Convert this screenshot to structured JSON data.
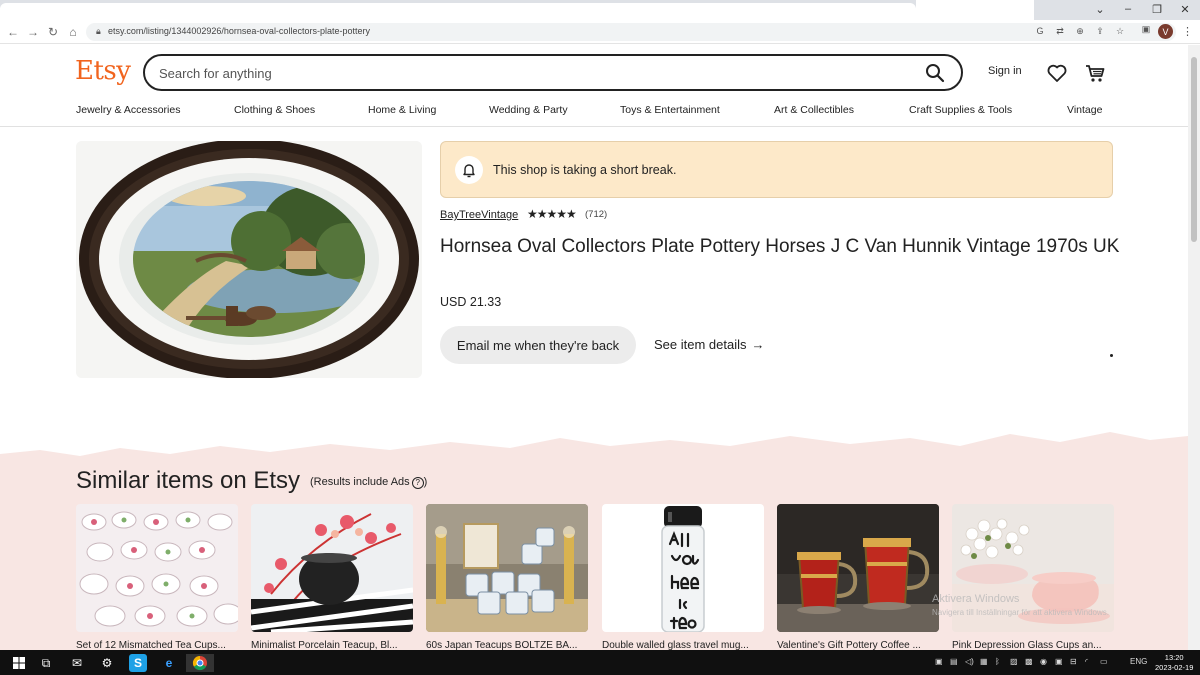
{
  "browser": {
    "url": "etsy.com/listing/1344002926/hornsea-oval-collectors-plate-pottery",
    "profile_initial": "V"
  },
  "header": {
    "logo": "Etsy",
    "search_placeholder": "Search for anything",
    "signin": "Sign in"
  },
  "categories": [
    "Jewelry & Accessories",
    "Clothing & Shoes",
    "Home & Living",
    "Wedding & Party",
    "Toys & Entertainment",
    "Art & Collectibles",
    "Craft Supplies & Tools",
    "Vintage"
  ],
  "listing": {
    "notice": "This shop is taking a short break.",
    "shop_name": "BayTreeVintage",
    "stars": "★★★★★",
    "reviews": "(712)",
    "title": "Hornsea Oval Collectors Plate Pottery Horses J C Van Hunnik Vintage 1970s UK",
    "price": "USD 21.33",
    "email_button": "Email me when they're back",
    "details_link": "See item details",
    "details_arrow": "→"
  },
  "similar": {
    "title": "Similar items on Etsy",
    "note": "(Results include Ads",
    "note_icon": "?",
    "note_close": ")",
    "items": [
      "Set of 12 Mismatched Tea Cups...",
      "Minimalist Porcelain Teacup, Bl...",
      "60s Japan Teacups BOLTZE BA...",
      "Double walled glass travel mug...",
      "Valentine's Gift Pottery Coffee ...",
      "Pink Depression Glass Cups an..."
    ]
  },
  "overlay": {
    "activate_windows": "Aktivera Windows",
    "activate_hint": "Navigera till Inställningar för att aktivera Windows."
  },
  "taskbar": {
    "lang": "ENG",
    "time": "13:20",
    "date": "2023-02-19"
  },
  "colors": {
    "brand": "#f1641e",
    "notice_bg": "#fde9c9",
    "similar_bg": "#f8e6e3"
  }
}
